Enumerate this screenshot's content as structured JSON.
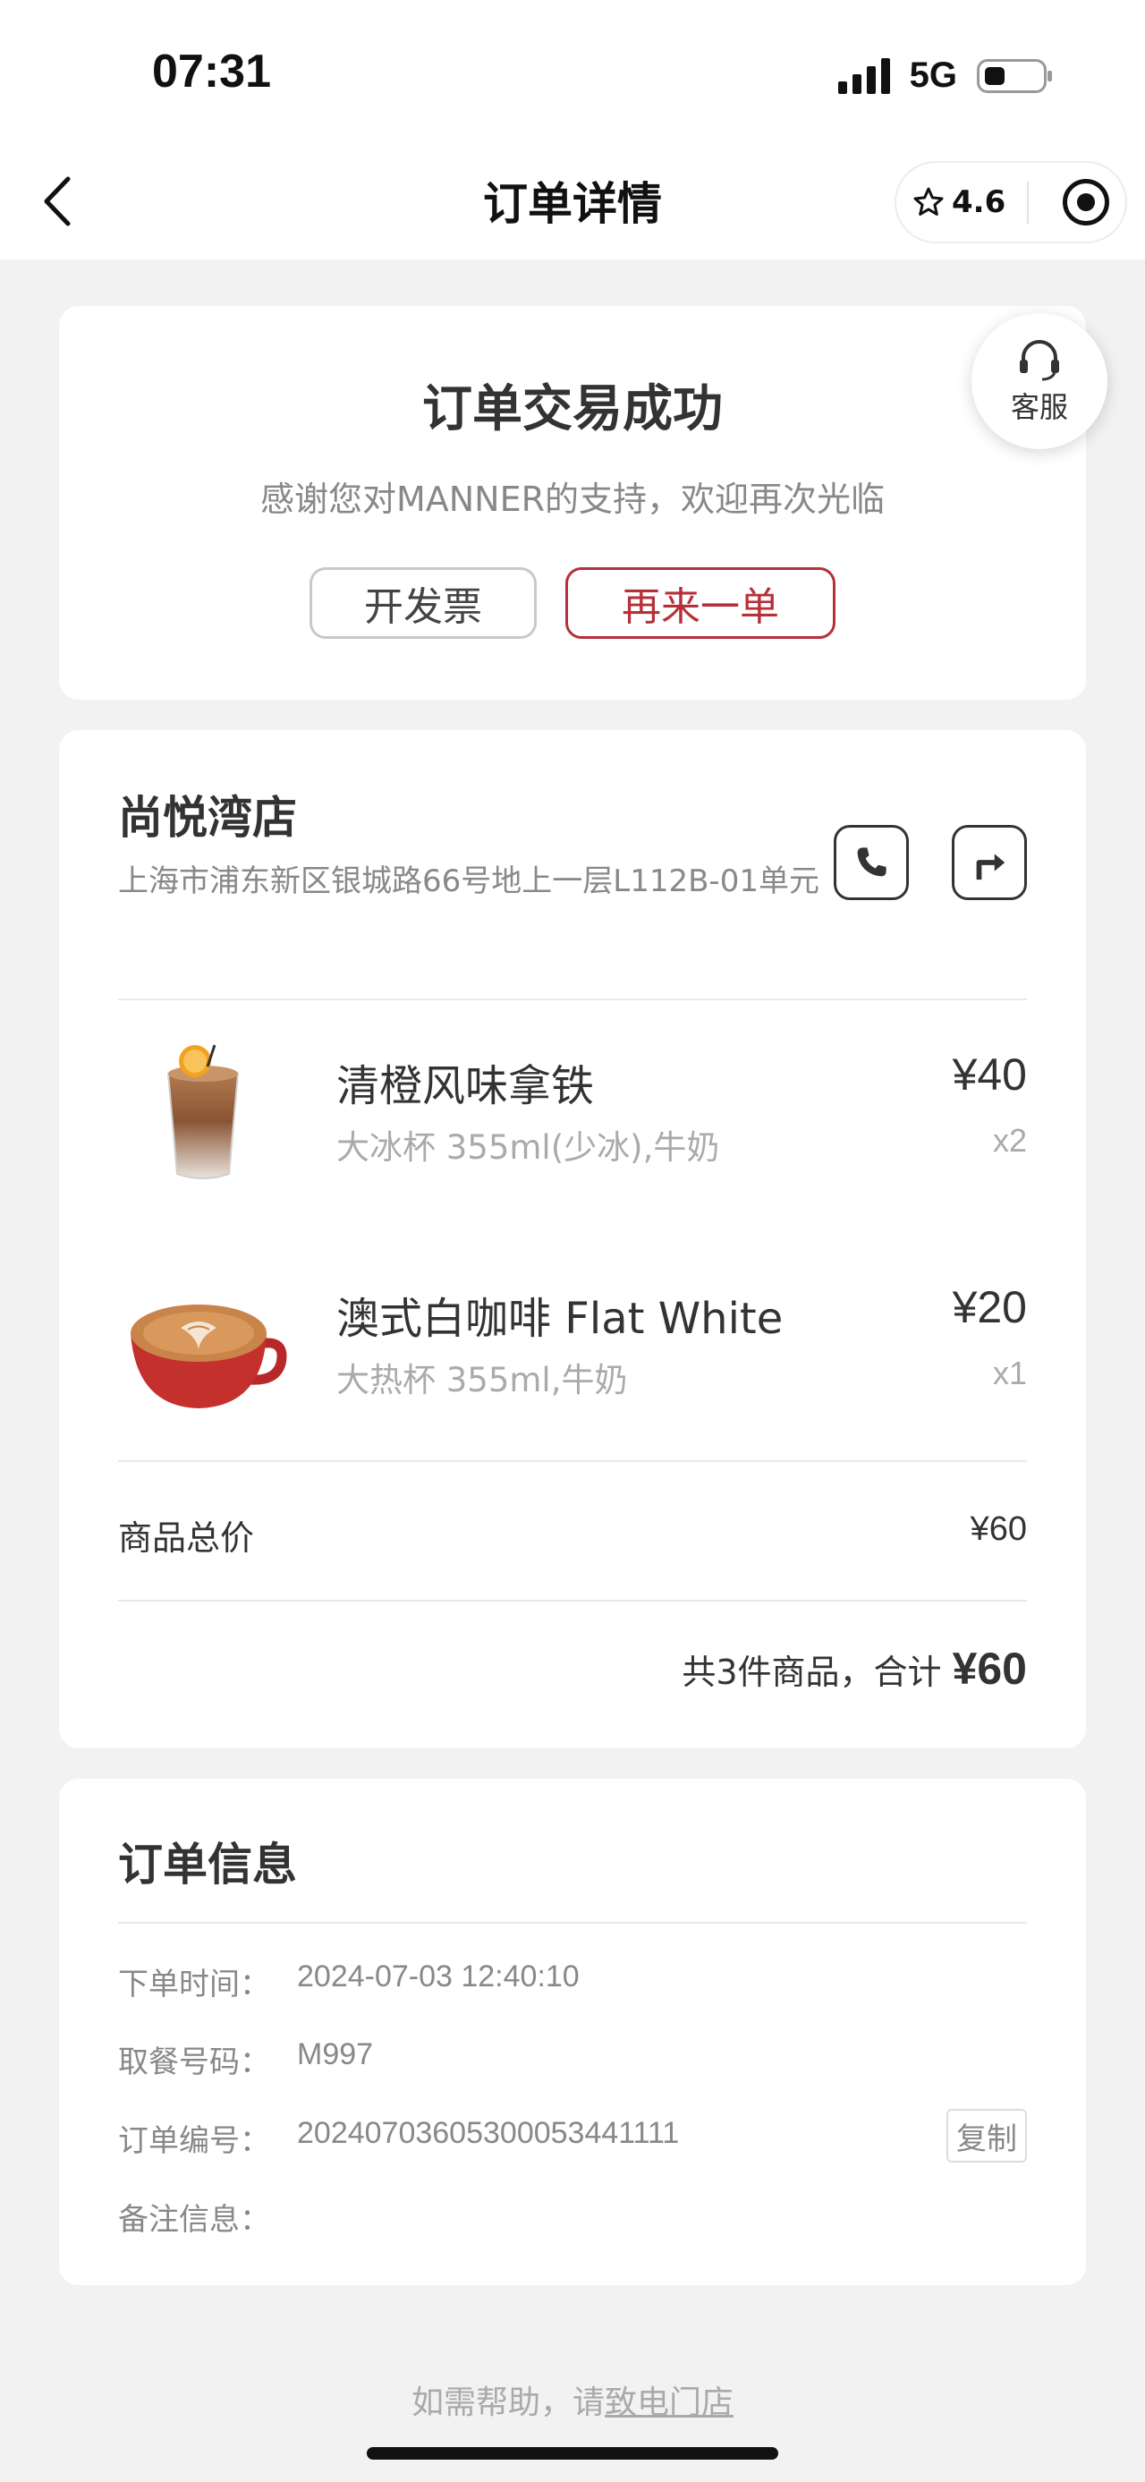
{
  "status_bar": {
    "time": "07:31",
    "network": "5G"
  },
  "nav": {
    "title": "订单详情",
    "rating": "4.6"
  },
  "order_status": {
    "title": "订单交易成功",
    "subtitle": "感谢您对MANNER的支持，欢迎再次光临",
    "invoice_label": "开发票",
    "reorder_label": "再来一单"
  },
  "customer_service": {
    "label": "客服"
  },
  "store": {
    "name": "尚悦湾店",
    "address": "上海市浦东新区银城路66号地上一层L112B-01单元"
  },
  "items": [
    {
      "name": "清橙风味拿铁",
      "options": "大冰杯 355ml(少冰),牛奶",
      "price": "¥40",
      "qty": "x2"
    },
    {
      "name": "澳式白咖啡 Flat White",
      "options": "大热杯 355ml,牛奶",
      "price": "¥20",
      "qty": "x1"
    }
  ],
  "totals": {
    "label": "商品总价",
    "value": "¥60",
    "summary_text": "共3件商品，合计",
    "summary_amount": "¥60"
  },
  "order_info": {
    "title": "订单信息",
    "rows": [
      {
        "label": "下单时间：",
        "value": "2024-07-03 12:40:10"
      },
      {
        "label": "取餐号码：",
        "value": "M997"
      },
      {
        "label": "订单编号：",
        "value": "20240703605300053441111"
      },
      {
        "label": "备注信息：",
        "value": ""
      }
    ],
    "copy_label": "复制"
  },
  "footer": {
    "help_prefix": "如需帮助，请",
    "help_link": "致电门店"
  },
  "colors": {
    "accent_red": "#b5313a",
    "background": "#f2f2f2"
  },
  "icons": [
    "back-chevron-icon",
    "star-icon",
    "target-icon",
    "headset-icon",
    "phone-icon",
    "navigate-icon"
  ]
}
